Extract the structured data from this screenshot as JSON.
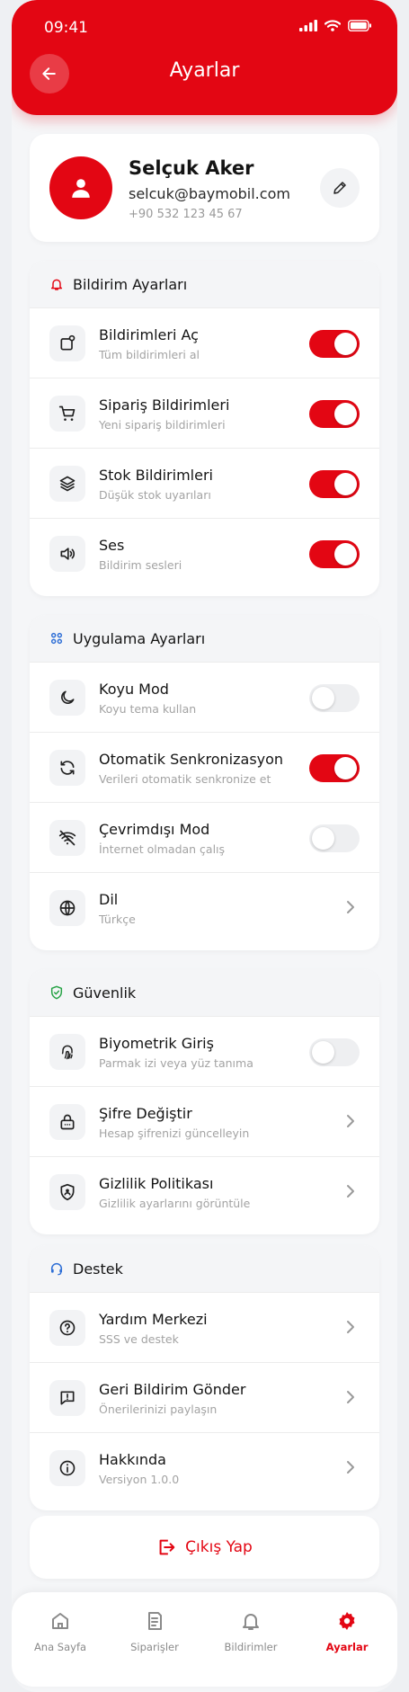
{
  "status_bar": {
    "time": "09:41"
  },
  "header": {
    "title": "Ayarlar"
  },
  "profile": {
    "name": "Selçuk Aker",
    "email": "selcuk@baymobil.com",
    "phone": "+90 532 123 45 67"
  },
  "sections": [
    {
      "title": "Bildirim Ayarları",
      "icon": "bell-icon",
      "items": [
        {
          "title": "Bildirimleri Aç",
          "subtitle": "Tüm bildirimleri al",
          "icon": "notification-icon",
          "control": "toggle",
          "on": true
        },
        {
          "title": "Sipariş Bildirimleri",
          "subtitle": "Yeni sipariş bildirimleri",
          "icon": "cart-icon",
          "control": "toggle",
          "on": true
        },
        {
          "title": "Stok Bildirimleri",
          "subtitle": "Düşük stok uyarıları",
          "icon": "layers-icon",
          "control": "toggle",
          "on": true
        },
        {
          "title": "Ses",
          "subtitle": "Bildirim sesleri",
          "icon": "volume-icon",
          "control": "toggle",
          "on": true
        }
      ]
    },
    {
      "title": "Uygulama Ayarları",
      "icon": "apps-icon",
      "items": [
        {
          "title": "Koyu Mod",
          "subtitle": "Koyu tema kullan",
          "icon": "moon-icon",
          "control": "toggle",
          "on": false
        },
        {
          "title": "Otomatik Senkronizasyon",
          "subtitle": "Verileri otomatik senkronize et",
          "icon": "sync-icon",
          "control": "toggle",
          "on": true
        },
        {
          "title": "Çevrimdışı Mod",
          "subtitle": "İnternet olmadan çalış",
          "icon": "wifi-off-icon",
          "control": "toggle",
          "on": false
        },
        {
          "title": "Dil",
          "subtitle": "Türkçe",
          "icon": "globe-icon",
          "control": "chevron"
        }
      ]
    },
    {
      "title": "Güvenlik",
      "icon": "shield-check-icon",
      "items": [
        {
          "title": "Biyometrik Giriş",
          "subtitle": "Parmak izi veya yüz tanıma",
          "icon": "fingerprint-icon",
          "control": "toggle",
          "on": false
        },
        {
          "title": "Şifre Değiştir",
          "subtitle": "Hesap şifrenizi güncelleyin",
          "icon": "lock-icon",
          "control": "chevron"
        },
        {
          "title": "Gizlilik Politikası",
          "subtitle": "Gizlilik ayarlarını görüntüle",
          "icon": "shield-user-icon",
          "control": "chevron"
        }
      ]
    },
    {
      "title": "Destek",
      "icon": "headset-icon",
      "items": [
        {
          "title": "Yardım Merkezi",
          "subtitle": "SSS ve destek",
          "icon": "help-icon",
          "control": "chevron"
        },
        {
          "title": "Geri Bildirim Gönder",
          "subtitle": "Önerilerinizi paylaşın",
          "icon": "feedback-icon",
          "control": "chevron"
        },
        {
          "title": "Hakkında",
          "subtitle": "Versiyon 1.0.0",
          "icon": "info-icon",
          "control": "chevron"
        }
      ]
    }
  ],
  "logout": {
    "label": "Çıkış Yap"
  },
  "bottom_nav": [
    {
      "label": "Ana Sayfa",
      "icon": "home-icon",
      "active": false
    },
    {
      "label": "Siparişler",
      "icon": "orders-icon",
      "active": false
    },
    {
      "label": "Bildirimler",
      "icon": "bell-icon",
      "active": false
    },
    {
      "label": "Ayarlar",
      "icon": "gear-icon",
      "active": true
    }
  ],
  "colors": {
    "accent": "#e30613",
    "background": "#f5f6f8",
    "card": "#ffffff"
  }
}
